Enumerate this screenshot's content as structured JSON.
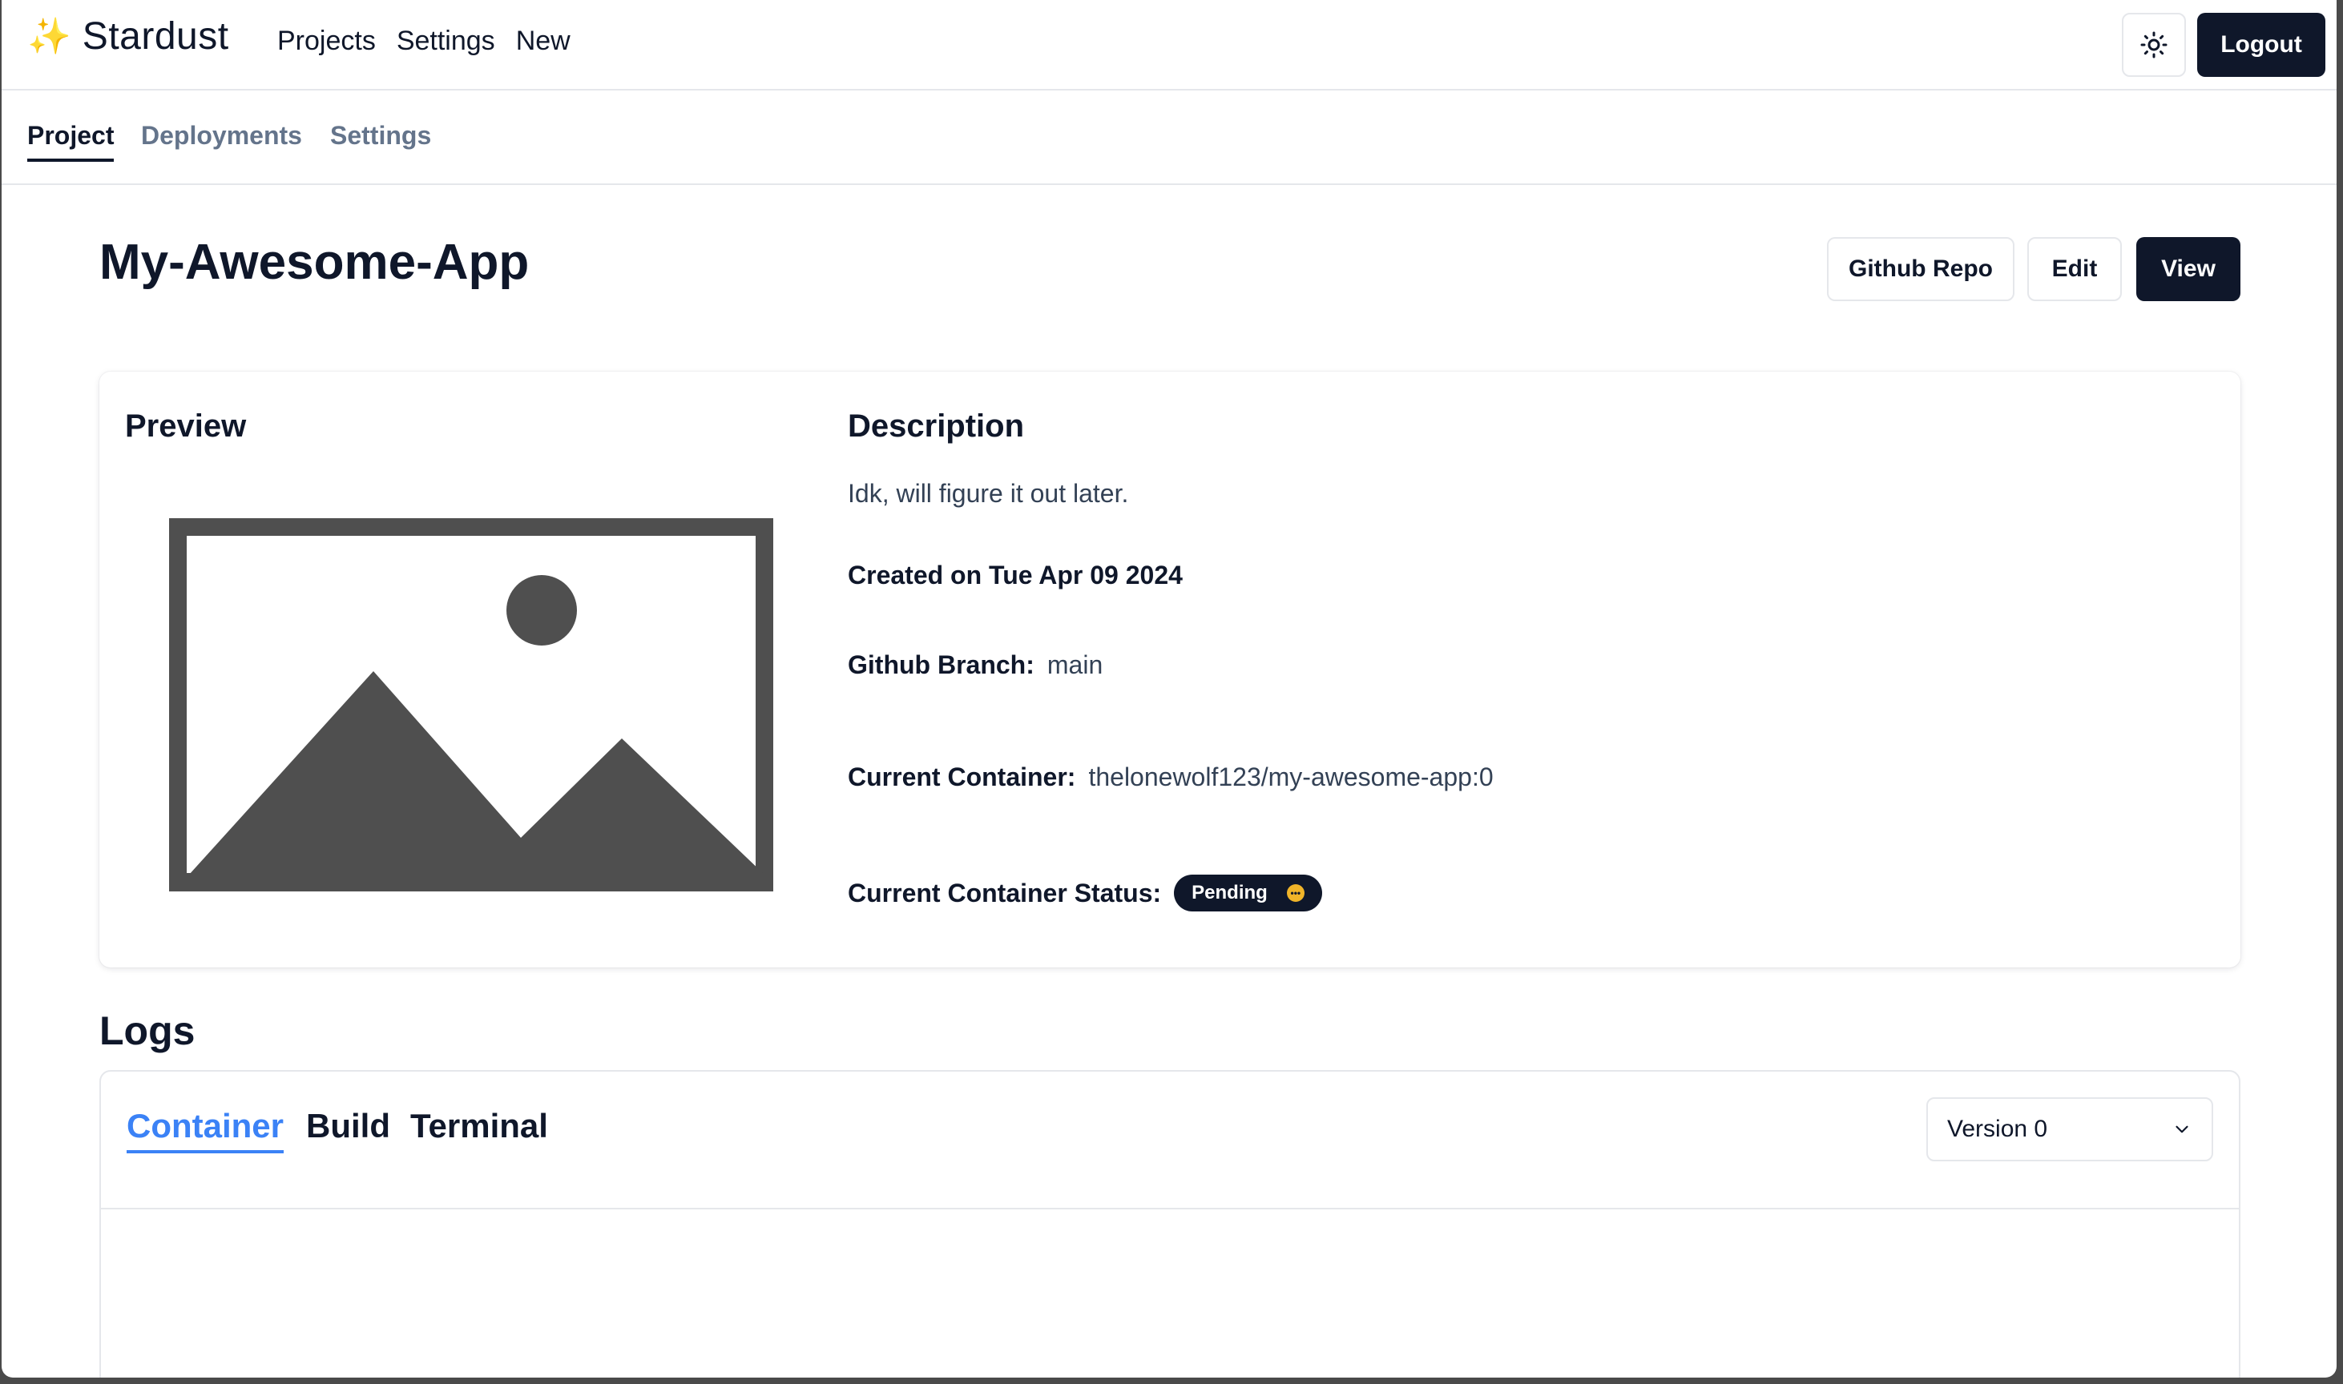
{
  "brand": {
    "icon": "✨",
    "name": "Stardust"
  },
  "topnav": {
    "links": [
      "Projects",
      "Settings",
      "New"
    ],
    "theme_icon": "sun-icon",
    "logout_label": "Logout"
  },
  "subnav": {
    "tabs": [
      "Project",
      "Deployments",
      "Settings"
    ],
    "active": "Project"
  },
  "project": {
    "title": "My-Awesome-App",
    "buttons": {
      "github": "Github Repo",
      "edit": "Edit",
      "view": "View"
    }
  },
  "card": {
    "preview_title": "Preview",
    "description_title": "Description",
    "description": "Idk, will figure it out later.",
    "created": "Created on Tue Apr 09 2024",
    "branch_label": "Github Branch:",
    "branch_value": "main",
    "container_label": "Current Container:",
    "container_value": "thelonewolf123/my-awesome-app:0",
    "status_label": "Current Container Status:",
    "status_value": "Pending",
    "status_color": "#f0b429"
  },
  "logs": {
    "title": "Logs",
    "tabs": [
      "Container",
      "Build",
      "Terminal"
    ],
    "active_tab": "Container",
    "accent": "#3b82f6",
    "version_selected": "Version 0"
  }
}
